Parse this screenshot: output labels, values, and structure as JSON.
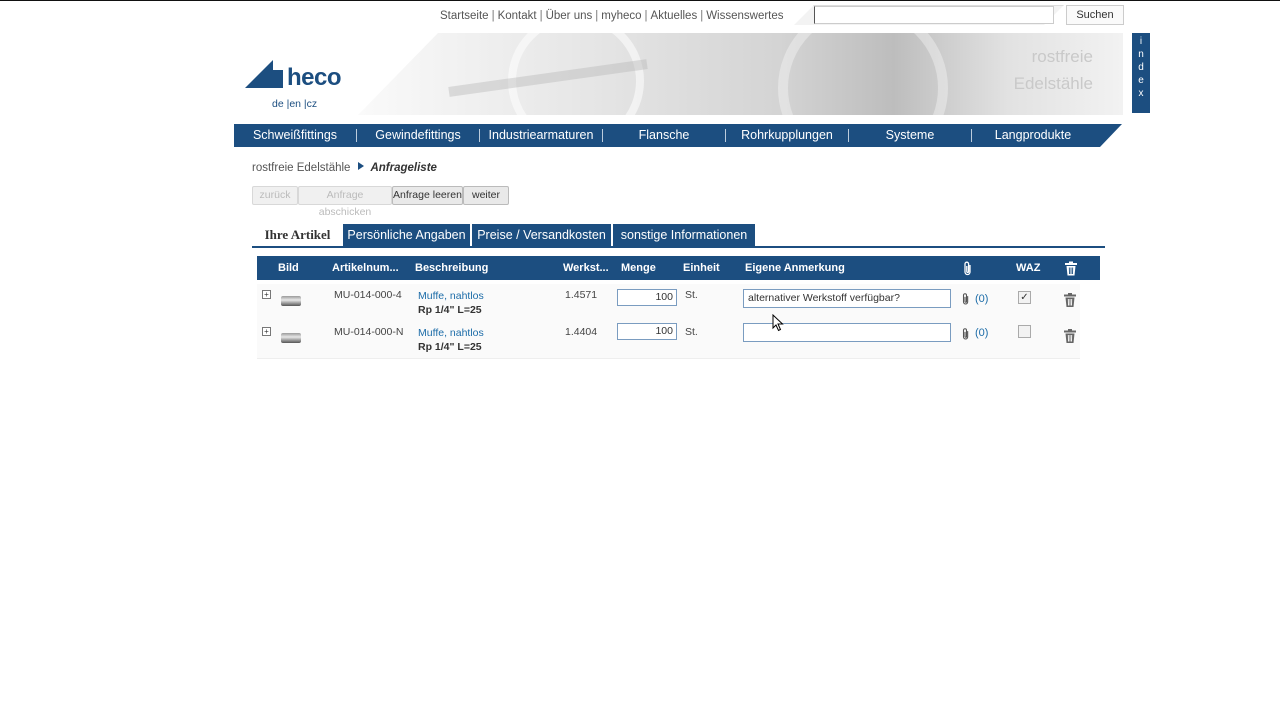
{
  "toplinks": [
    "Startseite",
    "Kontakt",
    "Über uns",
    "myheco",
    "Aktuelles",
    "Wissenswertes"
  ],
  "search": {
    "placeholder": "",
    "button_label": "Suchen"
  },
  "logo": {
    "text": "heco"
  },
  "languages": "de |en |cz",
  "banner": {
    "line1": "rostfreie",
    "line2": "Edelstähle"
  },
  "index_tab": [
    "i",
    "n",
    "d",
    "e",
    "x"
  ],
  "nav": [
    "Schweißfittings",
    "Gewindefittings",
    "Industriearmaturen",
    "Flansche",
    "Rohrkupplungen",
    "Systeme",
    "Langprodukte"
  ],
  "breadcrumb": {
    "parent": "rostfreie Edelstähle",
    "current": "Anfrageliste"
  },
  "actions": {
    "back": "zurück",
    "send": "Anfrage abschicken",
    "clear": "Anfrage leeren",
    "next": "weiter"
  },
  "tabs": [
    "Ihre Artikel",
    "Persönliche Angaben",
    "Preise / Versandkosten",
    "sonstige Informationen"
  ],
  "table": {
    "headers": {
      "image": "Bild",
      "article": "Artikelnum...",
      "description": "Beschreibung",
      "material": "Werkst...",
      "quantity": "Menge",
      "unit": "Einheit",
      "note": "Eigene Anmerkung",
      "waz": "WAZ"
    },
    "rows": [
      {
        "article": "MU-014-000-4",
        "desc_link": "Muffe, nahtlos",
        "desc_detail": "Rp 1/4\" L=25",
        "material": "1.4571",
        "quantity": "100",
        "unit": "St.",
        "note": "alternativer Werkstoff verfügbar?",
        "attachments": "(0)",
        "waz_checked": true
      },
      {
        "article": "MU-014-000-N",
        "desc_link": "Muffe, nahtlos",
        "desc_detail": "Rp 1/4\" L=25",
        "material": "1.4404",
        "quantity": "100",
        "unit": "St.",
        "note": "",
        "attachments": "(0)",
        "waz_checked": false
      }
    ]
  },
  "colors": {
    "brand": "#1c4e80",
    "link": "#1c6ca8"
  }
}
